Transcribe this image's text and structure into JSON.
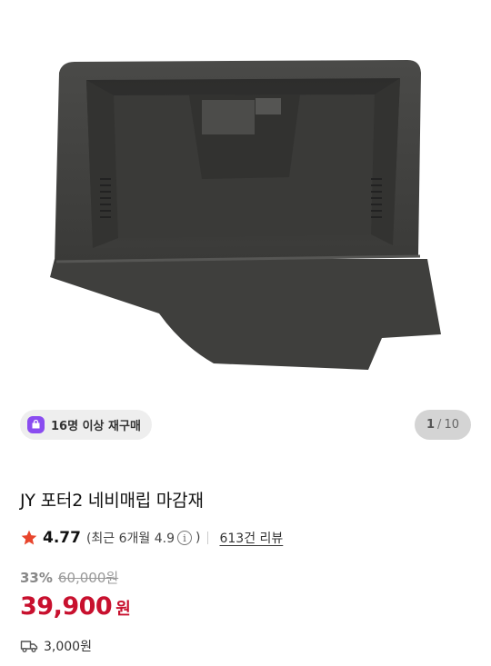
{
  "product": {
    "image_alt": "JY 포터2 네비매립 마감재",
    "repurchase_badge": "16명 이상 재구매",
    "pager": {
      "current": "1",
      "separator": "/",
      "total": "10"
    },
    "title": "JY 포터2 네비매립 마감재",
    "rating": {
      "value": "4.77",
      "recent_text": "(최근 6개월 4.9",
      "info_icon_glyph": "i",
      "recent_close": ")",
      "reviews": "613건 리뷰"
    },
    "price": {
      "discount": "33%",
      "original": "60,000원",
      "sale": "39,900",
      "unit": "원"
    },
    "shipping": {
      "icon": "truck-icon",
      "fee": "3,000원"
    }
  },
  "colors": {
    "accent_price": "#c8102e",
    "star": "#e8452c",
    "badge_icon": "#8a4cf0"
  }
}
